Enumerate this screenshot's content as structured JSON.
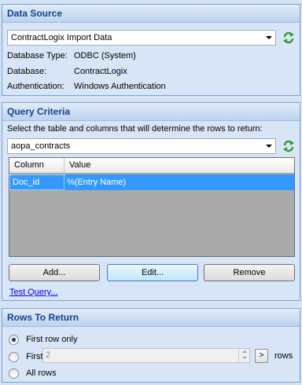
{
  "colors": {
    "header_text": "#15428b",
    "panel_bg": "#d7e5f6",
    "selection": "#3399ff",
    "refresh_green": "#2e9c2e"
  },
  "data_source": {
    "title": "Data Source",
    "selected": "ContractLogix Import Data",
    "refresh_icon": "refresh-icon",
    "fields": [
      {
        "label": "Database Type:",
        "value": "ODBC (System)"
      },
      {
        "label": "Database:",
        "value": "ContractLogix"
      },
      {
        "label": "Authentication:",
        "value": "Windows Authentication"
      }
    ]
  },
  "query_criteria": {
    "title": "Query Criteria",
    "instruction": "Select the table and columns that will determine the rows to return:",
    "table_selected": "aopa_contracts",
    "grid": {
      "headers": [
        "Column",
        "Value"
      ],
      "rows": [
        {
          "column": "Doc_id",
          "value": "%(Entry Name)"
        }
      ]
    },
    "buttons": {
      "add": "Add...",
      "edit": "Edit...",
      "remove": "Remove"
    },
    "test_link": "Test Query..."
  },
  "rows_to_return": {
    "title": "Rows To Return",
    "options": {
      "first_row_only": "First row only",
      "first": "First",
      "all_rows": "All rows"
    },
    "selected": "first_row_only",
    "count_value": "2",
    "count_button": ">",
    "rows_suffix": "rows"
  }
}
